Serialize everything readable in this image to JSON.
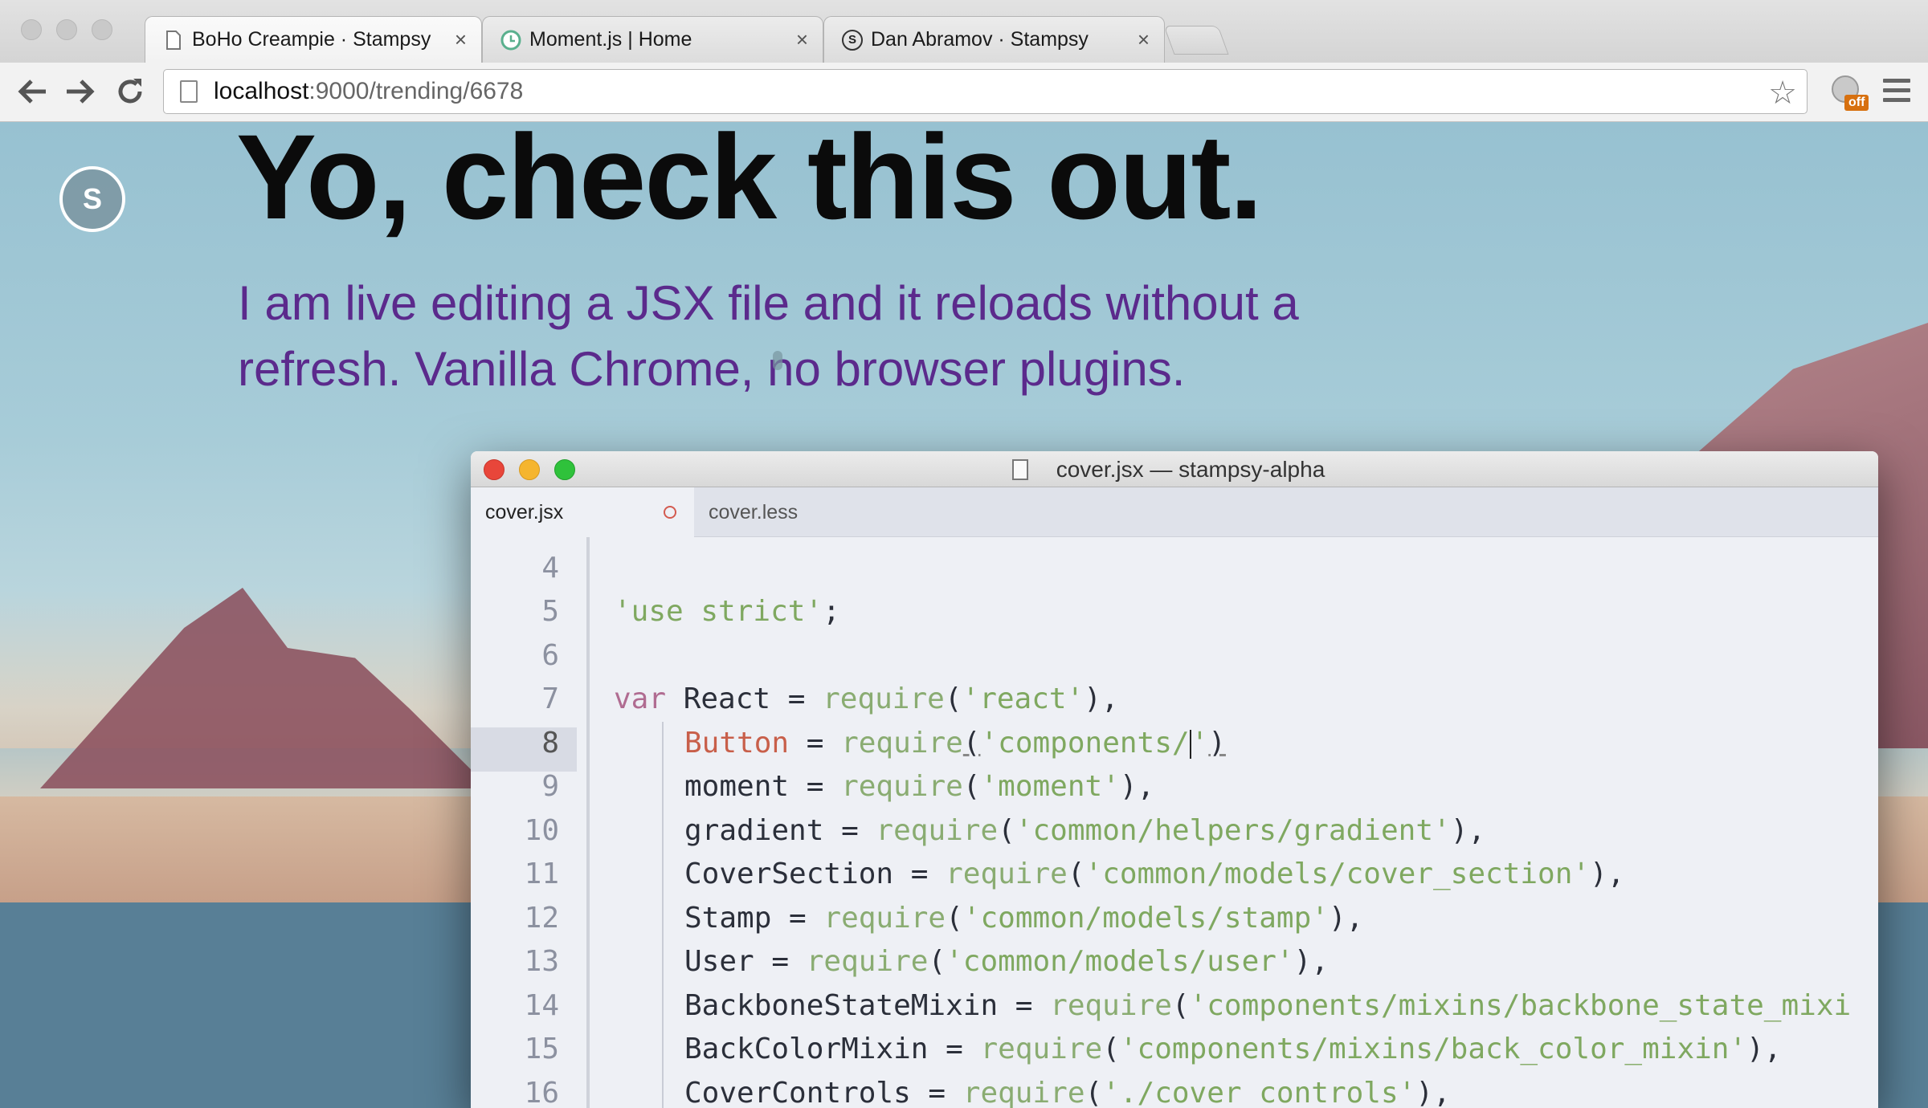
{
  "browser": {
    "tabs": [
      {
        "title": "BoHo Creampie · Stampsy",
        "close": "×",
        "favicon": "page-icon"
      },
      {
        "title": "Moment.js | Home",
        "close": "×",
        "favicon": "clock-icon"
      },
      {
        "title": "Dan Abramov · Stampsy",
        "close": "×",
        "favicon": "S"
      }
    ],
    "url_host": "localhost",
    "url_rest": ":9000/trending/6678",
    "ext_badge": "off"
  },
  "page": {
    "logo_letter": "S",
    "headline": "Yo, check this out.",
    "subtext": "I am live editing a JSX file and it reloads without a refresh. Vanilla Chrome, no browser plugins."
  },
  "editor": {
    "window_title": "cover.jsx — stampsy-alpha",
    "tabs": [
      {
        "label": "cover.jsx"
      },
      {
        "label": "cover.less"
      }
    ],
    "line_numbers": [
      "4",
      "5",
      "6",
      "7",
      "8",
      "9",
      "10",
      "11",
      "12",
      "13",
      "14",
      "15",
      "16"
    ],
    "lines": {
      "l5_str": "'use strict'",
      "l5_end": ";",
      "l7_kw": "var",
      "l7_id": " React = ",
      "l7_fn": "require",
      "l7_p1": "(",
      "l7_str": "'react'",
      "l7_p2": "),",
      "l8_id": "Button",
      "l8_eq": " = ",
      "l8_fn": "require",
      "l8_p1": "(",
      "l8_str": "'components/",
      "l8_str2": "'",
      "l8_p2": ")",
      "l9_id": "moment = ",
      "l9_fn": "require",
      "l9_str": "'moment'",
      "l10_id": "gradient = ",
      "l10_fn": "require",
      "l10_str": "'common/helpers/gradient'",
      "l11_id": "CoverSection = ",
      "l11_fn": "require",
      "l11_str": "'common/models/cover_section'",
      "l12_id": "Stamp = ",
      "l12_fn": "require",
      "l12_str": "'common/models/stamp'",
      "l13_id": "User = ",
      "l13_fn": "require",
      "l13_str": "'common/models/user'",
      "l14_id": "BackboneStateMixin = ",
      "l14_fn": "require",
      "l14_str": "'components/mixins/backbone_state_mixi",
      "l15_id": "BackColorMixin = ",
      "l15_fn": "require",
      "l15_str": "'components/mixins/back_color_mixin'",
      "l16_id": "CoverControls = ",
      "l16_fn": "require",
      "l16_str": "'./cover_controls'",
      "open": "(",
      "close_comma": "),"
    }
  },
  "colors": {
    "headline": "#0b0b0b",
    "subtext": "#5b2a8c",
    "keyword": "#b06c91",
    "function": "#8aac72",
    "string": "#7fa860",
    "error_identifier": "#c85f4a",
    "close_light": "#e8463a",
    "minimize_light": "#f5b52e",
    "zoom_light": "#2fc23b"
  }
}
